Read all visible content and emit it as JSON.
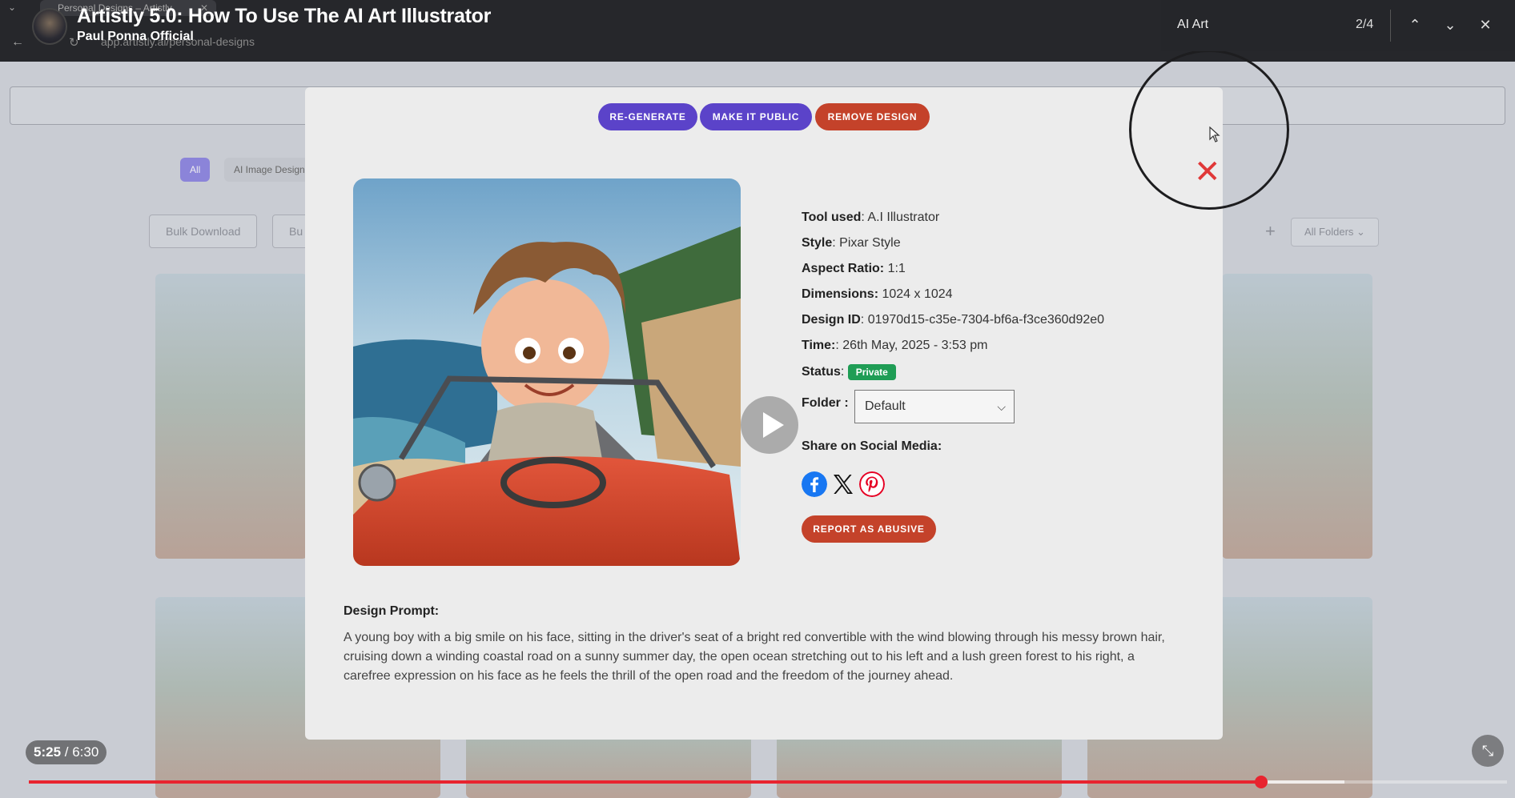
{
  "browser": {
    "tab_title": "Personal Designs – Artistly",
    "url": "app.artistly.ai/personal-designs"
  },
  "video": {
    "title": "Artistly 5.0: How To Use The AI Art Illustrator",
    "channel": "Paul Ponna Official",
    "time_current": "5:25",
    "time_separator": " / ",
    "time_total": "6:30",
    "progress_fraction": 0.8338,
    "buffer_fraction": 0.89
  },
  "find_bar": {
    "query": "AI Art",
    "count": "2/4"
  },
  "background_app": {
    "filter_all": "All",
    "filter_ai": "AI Image Design",
    "bulk_download": "Bulk Download",
    "bulk_other": "Bu",
    "folders_dropdown": "All Folders"
  },
  "modal": {
    "buttons": {
      "regenerate": "RE-GENERATE",
      "make_public": "MAKE IT PUBLIC",
      "remove": "REMOVE DESIGN",
      "report": "REPORT AS ABUSIVE"
    },
    "info": {
      "tool_label": "Tool used",
      "tool_value": "A.I Illustrator",
      "style_label": "Style",
      "style_value": "Pixar Style",
      "aspect_label": "Aspect Ratio:",
      "aspect_value": "1:1",
      "dimensions_label": "Dimensions:",
      "dimensions_value": "1024 x 1024",
      "design_id_label": "Design ID",
      "design_id_value": "01970d15-c35e-7304-bf6a-f3ce360d92e0",
      "time_label": "Time:",
      "time_value": "26th May, 2025 - 3:53 pm",
      "status_label": "Status",
      "status_value": "Private",
      "folder_label": "Folder :",
      "folder_value": "Default",
      "share_label": "Share on Social Media:"
    },
    "prompt_label": "Design Prompt:",
    "prompt_text": "A young boy with a big smile on his face, sitting in the driver's seat of a bright red convertible with the wind blowing through his messy brown hair, cruising down a winding coastal road on a sunny summer day, the open ocean stretching out to his left and a lush green forest to his right, a carefree expression on his face as he feels the thrill of the open road and the freedom of the journey ahead."
  },
  "colors": {
    "primary": "#5b43c9",
    "danger": "#c4422a",
    "status_private": "#1f9d55",
    "progress": "#e8242f"
  }
}
